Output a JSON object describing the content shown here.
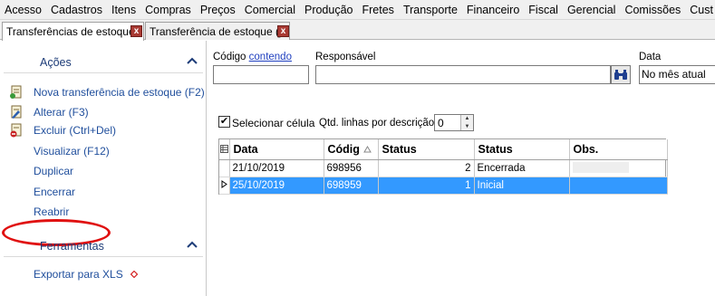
{
  "menubar": [
    "Acesso",
    "Cadastros",
    "Itens",
    "Compras",
    "Preços",
    "Comercial",
    "Produção",
    "Fretes",
    "Transporte",
    "Financeiro",
    "Fiscal",
    "Gerencial",
    "Comissões",
    "Cust"
  ],
  "tabs": [
    {
      "label": "Transferências de estoque",
      "close": "x"
    },
    {
      "label": "Transferência de estoque ()",
      "close": "x"
    }
  ],
  "sidebar": {
    "actions_title": "Ações",
    "actions": [
      {
        "label": "Nova transferência de estoque (F2)",
        "icon": "new-document-icon"
      },
      {
        "label": "Alterar (F3)",
        "icon": "edit-document-icon"
      },
      {
        "label": "Excluir (Ctrl+Del)",
        "icon": "delete-document-icon"
      },
      {
        "label": "Visualizar (F12)",
        "icon": ""
      },
      {
        "label": "Duplicar",
        "icon": ""
      },
      {
        "label": "Encerrar",
        "icon": ""
      },
      {
        "label": "Reabrir",
        "icon": ""
      }
    ],
    "tools_title": "Ferramentas",
    "tools": [
      {
        "label": "Exportar para XLS"
      }
    ]
  },
  "filters": {
    "codigo_label": "Código",
    "codigo_mode": "contendo",
    "codigo_value": "",
    "responsavel_label": "Responsável",
    "responsavel_value": "",
    "data_label": "Data",
    "data_value": "No mês atual"
  },
  "options": {
    "selecionar_celula": "Selecionar célula",
    "selecionar_checked": true,
    "qtd_label": "Qtd. linhas por descrição",
    "qtd_value": "0"
  },
  "grid": {
    "columns": [
      "Data",
      "Códig",
      "Status",
      "Status",
      "Obs."
    ],
    "rows": [
      {
        "data": "21/10/2019",
        "codigo": "698956",
        "status_num": "2",
        "status": "Encerrada",
        "obs": "",
        "selected": false
      },
      {
        "data": "25/10/2019",
        "codigo": "698959",
        "status_num": "1",
        "status": "Inicial",
        "obs": "",
        "selected": true
      }
    ]
  },
  "colors": {
    "selection": "#3399ff",
    "link": "#1f4e9c",
    "highlight_oval": "#e01010"
  }
}
